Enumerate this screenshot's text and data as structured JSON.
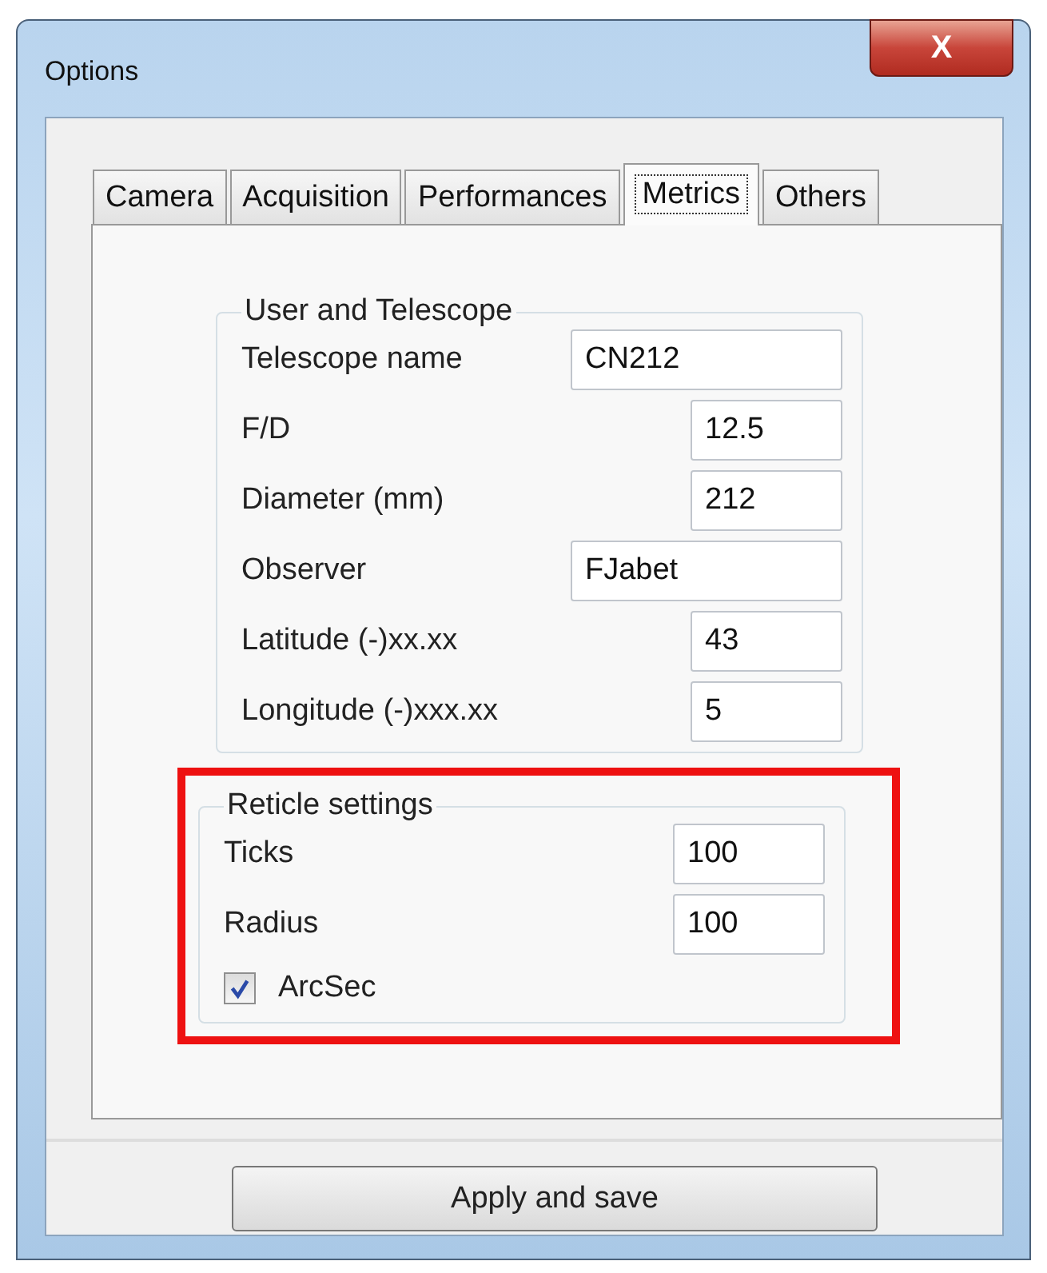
{
  "window": {
    "title": "Options",
    "close_label": "X"
  },
  "tabs": [
    {
      "label": "Camera",
      "selected": false
    },
    {
      "label": "Acquisition",
      "selected": false
    },
    {
      "label": "Performances",
      "selected": false
    },
    {
      "label": "Metrics",
      "selected": true
    },
    {
      "label": "Others",
      "selected": false
    }
  ],
  "groups": [
    {
      "title": "User and Telescope",
      "highlighted": false,
      "rows": [
        {
          "kind": "text",
          "label": "Telescope name",
          "value": "CN212"
        },
        {
          "kind": "number",
          "label": "F/D",
          "value": "12.5"
        },
        {
          "kind": "number",
          "label": "Diameter (mm)",
          "value": "212"
        },
        {
          "kind": "text",
          "label": "Observer",
          "value": "FJabet"
        },
        {
          "kind": "number",
          "label": "Latitude (-)xx.xx",
          "value": "43"
        },
        {
          "kind": "number",
          "label": "Longitude (-)xxx.xx",
          "value": "5"
        }
      ]
    },
    {
      "title": "Reticle settings",
      "highlighted": true,
      "rows": [
        {
          "kind": "number",
          "label": "Ticks",
          "value": "100"
        },
        {
          "kind": "number",
          "label": "Radius",
          "value": "100"
        },
        {
          "kind": "checkbox",
          "label": "ArcSec",
          "checked": true
        }
      ]
    }
  ],
  "button": "Apply and save"
}
